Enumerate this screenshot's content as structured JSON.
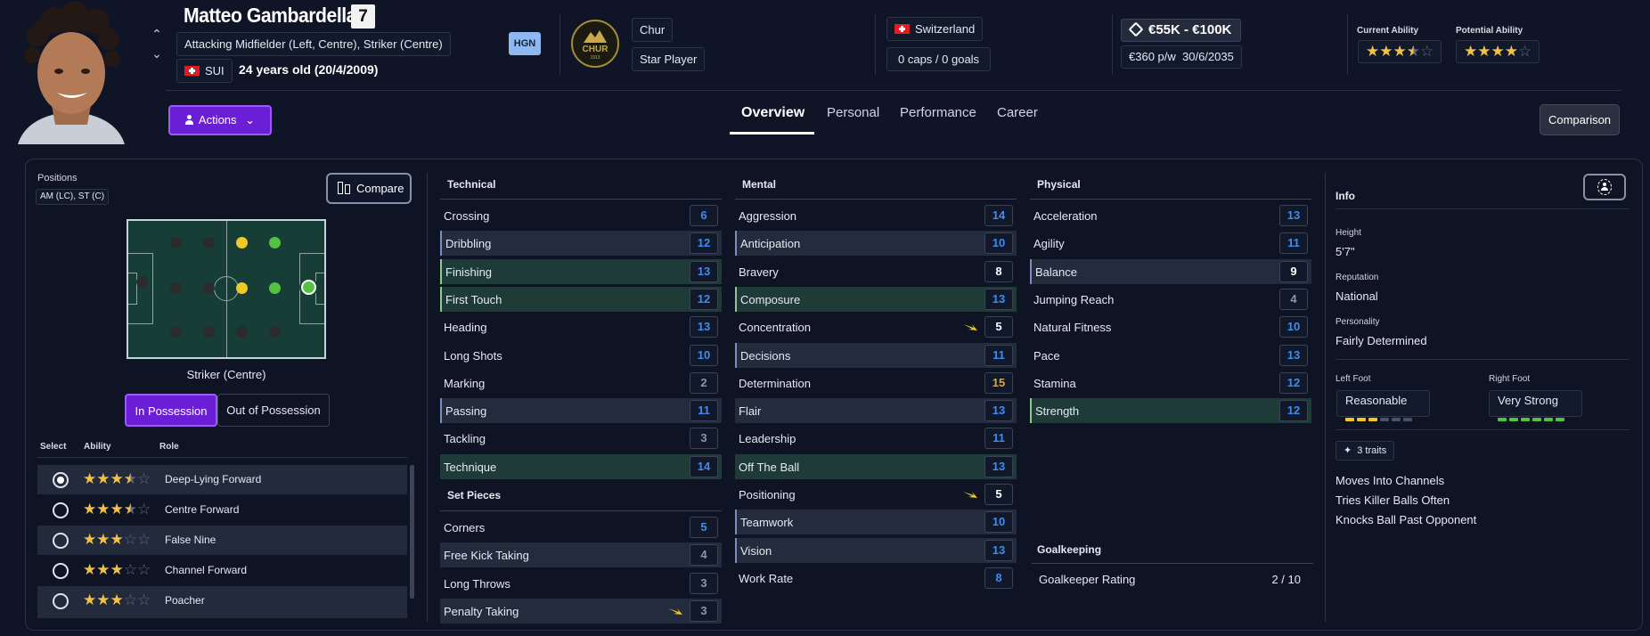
{
  "player": {
    "name": "Matteo Gambardella",
    "number": "7",
    "position_desc": "Attacking Midfielder (Left, Centre), Striker (Centre)",
    "nation_code": "SUI",
    "age": "24 years old (20/4/2009)",
    "tag": "HGN"
  },
  "club": {
    "name": "Chur",
    "status": "Star Player",
    "logo_text": "CHUR",
    "logo_year": "1913"
  },
  "nation": {
    "name": "Switzerland",
    "caps": "0 caps / 0 goals"
  },
  "contract": {
    "value": "€55K - €100K",
    "wage": "€360 p/w",
    "expiry": "30/6/2035"
  },
  "ability": {
    "current_label": "Current Ability",
    "potential_label": "Potential Ability",
    "current_stars": 3.5,
    "potential_stars": 4
  },
  "actions_label": "Actions",
  "tabs": [
    "Overview",
    "Personal",
    "Performance",
    "Career"
  ],
  "comparison_label": "Comparison",
  "positions": {
    "label": "Positions",
    "value": "AM (LC), ST (C)",
    "compare_label": "Compare",
    "caption": "Striker (Centre)",
    "toggle_in": "In Possession",
    "toggle_out": "Out of Possession"
  },
  "roles": {
    "headers": [
      "Select",
      "Ability",
      "Role"
    ],
    "items": [
      {
        "name": "Deep-Lying Forward",
        "stars": 3.5,
        "selected": true
      },
      {
        "name": "Centre Forward",
        "stars": 3.5,
        "selected": false
      },
      {
        "name": "False Nine",
        "stars": 3,
        "selected": false
      },
      {
        "name": "Channel Forward",
        "stars": 3,
        "selected": false
      },
      {
        "name": "Poacher",
        "stars": 3,
        "selected": false
      }
    ]
  },
  "attributes": {
    "technical": {
      "title": "Technical",
      "items": [
        {
          "name": "Crossing",
          "value": "6"
        },
        {
          "name": "Dribbling",
          "value": "12"
        },
        {
          "name": "Finishing",
          "value": "13"
        },
        {
          "name": "First Touch",
          "value": "12"
        },
        {
          "name": "Heading",
          "value": "13"
        },
        {
          "name": "Long Shots",
          "value": "10"
        },
        {
          "name": "Marking",
          "value": "2"
        },
        {
          "name": "Passing",
          "value": "11"
        },
        {
          "name": "Tackling",
          "value": "3"
        },
        {
          "name": "Technique",
          "value": "14"
        }
      ]
    },
    "set_pieces": {
      "title": "Set Pieces",
      "items": [
        {
          "name": "Corners",
          "value": "5"
        },
        {
          "name": "Free Kick Taking",
          "value": "4"
        },
        {
          "name": "Long Throws",
          "value": "3"
        },
        {
          "name": "Penalty Taking",
          "value": "3"
        }
      ]
    },
    "mental": {
      "title": "Mental",
      "items": [
        {
          "name": "Aggression",
          "value": "14"
        },
        {
          "name": "Anticipation",
          "value": "10"
        },
        {
          "name": "Bravery",
          "value": "8"
        },
        {
          "name": "Composure",
          "value": "13"
        },
        {
          "name": "Concentration",
          "value": "5"
        },
        {
          "name": "Decisions",
          "value": "11"
        },
        {
          "name": "Determination",
          "value": "15"
        },
        {
          "name": "Flair",
          "value": "13"
        },
        {
          "name": "Leadership",
          "value": "11"
        },
        {
          "name": "Off The Ball",
          "value": "13"
        },
        {
          "name": "Positioning",
          "value": "5"
        },
        {
          "name": "Teamwork",
          "value": "10"
        },
        {
          "name": "Vision",
          "value": "13"
        },
        {
          "name": "Work Rate",
          "value": "8"
        }
      ]
    },
    "physical": {
      "title": "Physical",
      "items": [
        {
          "name": "Acceleration",
          "value": "13"
        },
        {
          "name": "Agility",
          "value": "11"
        },
        {
          "name": "Balance",
          "value": "9"
        },
        {
          "name": "Jumping Reach",
          "value": "4"
        },
        {
          "name": "Natural Fitness",
          "value": "10"
        },
        {
          "name": "Pace",
          "value": "13"
        },
        {
          "name": "Stamina",
          "value": "12"
        },
        {
          "name": "Strength",
          "value": "12"
        }
      ]
    },
    "goalkeeping": {
      "title": "Goalkeeping",
      "label": "Goalkeeper Rating",
      "value": "2 / 10"
    }
  },
  "info": {
    "title": "Info",
    "height_label": "Height",
    "height": "5'7\"",
    "reputation_label": "Reputation",
    "reputation": "National",
    "personality_label": "Personality",
    "personality": "Fairly Determined",
    "left_foot_label": "Left Foot",
    "left_foot": "Reasonable",
    "right_foot_label": "Right Foot",
    "right_foot": "Very Strong",
    "left_foot_level": 3,
    "right_foot_level": 6,
    "traits_label": "3 traits",
    "traits": [
      "Moves Into Channels",
      "Tries Killer Balls Often",
      "Knocks Ball Past Opponent"
    ]
  },
  "colors": {
    "accent": "#6a1fd6",
    "star": "#f1c246",
    "attr_blue": "#3d8df0",
    "attr_gold": "#e0a82a"
  }
}
